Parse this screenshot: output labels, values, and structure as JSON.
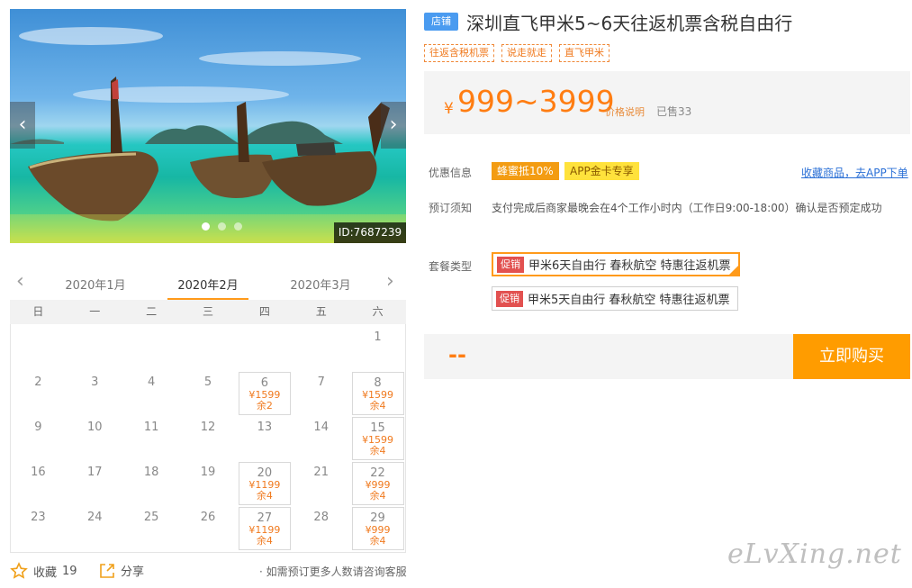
{
  "carousel": {
    "prev": "‹",
    "next": "›",
    "photo_id": "ID:7687239",
    "slide_count": 3,
    "active_slide": 0
  },
  "calendar": {
    "prev_arrow": "‹",
    "next_arrow": "›",
    "months": [
      "2020年1月",
      "2020年2月",
      "2020年3月"
    ],
    "active_month": "2020年2月",
    "weekdays": [
      "日",
      "一",
      "二",
      "三",
      "四",
      "五",
      "六"
    ],
    "weeks": [
      [
        null,
        null,
        null,
        null,
        null,
        null,
        {
          "day": "1"
        }
      ],
      [
        {
          "day": "2"
        },
        {
          "day": "3"
        },
        {
          "day": "4"
        },
        {
          "day": "5"
        },
        {
          "day": "6",
          "price": "¥1599",
          "stock": "余2"
        },
        {
          "day": "7"
        },
        {
          "day": "8",
          "price": "¥1599",
          "stock": "余4"
        }
      ],
      [
        {
          "day": "9"
        },
        {
          "day": "10"
        },
        {
          "day": "11"
        },
        {
          "day": "12"
        },
        {
          "day": "13"
        },
        {
          "day": "14"
        },
        {
          "day": "15",
          "price": "¥1599",
          "stock": "余4"
        }
      ],
      [
        {
          "day": "16"
        },
        {
          "day": "17"
        },
        {
          "day": "18"
        },
        {
          "day": "19"
        },
        {
          "day": "20",
          "price": "¥1199",
          "stock": "余4"
        },
        {
          "day": "21"
        },
        {
          "day": "22",
          "price": "¥999",
          "stock": "余4"
        }
      ],
      [
        {
          "day": "23"
        },
        {
          "day": "24"
        },
        {
          "day": "25"
        },
        {
          "day": "26"
        },
        {
          "day": "27",
          "price": "¥1199",
          "stock": "余4"
        },
        {
          "day": "28"
        },
        {
          "day": "29",
          "price": "¥999",
          "stock": "余4"
        }
      ]
    ]
  },
  "actions": {
    "favorite_label": "收藏",
    "favorite_count": "19",
    "share_label": "分享",
    "hint": "· 如需预订更多人数请咨询客服"
  },
  "product": {
    "store_badge": "店铺",
    "title": "深圳直飞甲米5~6天往返机票含税自由行",
    "tags": [
      "往返含税机票",
      "说走就走",
      "直飞甲米"
    ],
    "price_symbol": "¥",
    "price_range": "999~3999",
    "price_explain": "价格说明",
    "sold": "已售33"
  },
  "offers": {
    "label": "优惠信息",
    "promo_1": "蜂蜜抵10%",
    "promo_2": "APP金卡专享",
    "app_link": "收藏商品，去APP下单"
  },
  "booking": {
    "label": "预订须知",
    "notice": "支付完成后商家最晚会在4个工作小时内（工作日9:00-18:00）确认是否预定成功"
  },
  "packages": {
    "label": "套餐类型",
    "items": [
      {
        "tag": "促销",
        "name": "甲米6天自由行 春秋航空 特惠往返机票",
        "selected": true
      },
      {
        "tag": "促销",
        "name": "甲米5天自由行 春秋航空 特惠往返机票",
        "selected": false
      }
    ]
  },
  "purchase": {
    "price_placeholder": "--",
    "buy_label": "立即购买"
  },
  "watermark": "eLvXing.net",
  "colors": {
    "accent": "#ff9c00",
    "price": "#ff7d12",
    "promo_tag": "#e25150",
    "link": "#2a6fd6",
    "store_badge": "#4a9bf0"
  }
}
